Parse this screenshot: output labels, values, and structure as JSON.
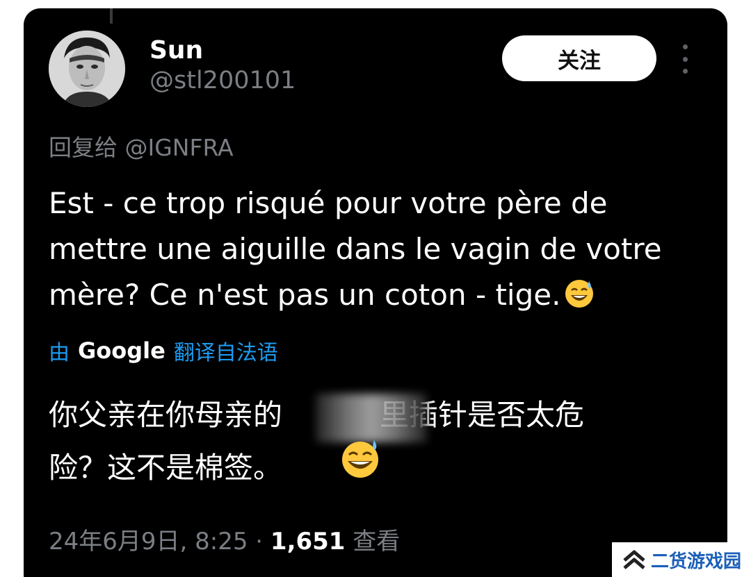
{
  "tweet": {
    "author": {
      "display_name": "Sun",
      "handle": "@stl200101",
      "avatar_icon": "person-portrait-avatar"
    },
    "follow_label": "关注",
    "more_icon": "more-vertical-icon",
    "reply_to": "回复给 @IGNFRA",
    "text_lines": [
      "Est - ce trop risqué pour votre père de",
      "mettre une aiguille dans le vagin de votre",
      "mère? Ce n'est pas un coton - tige."
    ],
    "text_emoji": "grinning-sweat-emoji",
    "translation": {
      "prefix": "由",
      "provider": "Google",
      "suffix": "翻译自法语"
    },
    "translated_lines": [
      "你父亲在你母亲的",
      "里插针是否太危",
      "险？这不是棉签。"
    ],
    "translated_emoji": "grinning-sweat-emoji",
    "timestamp": "24年6月9日, 8:25 · ",
    "views_count": "1,651",
    "views_label": " 查看"
  },
  "watermark": {
    "text": "二货游戏园",
    "icon": "double-chevron-up-icon"
  },
  "colors": {
    "background": "#000000",
    "text": "#ffffff",
    "muted": "#7b7f84",
    "link": "#1d9bf0",
    "watermark": "#1b5fb8"
  }
}
